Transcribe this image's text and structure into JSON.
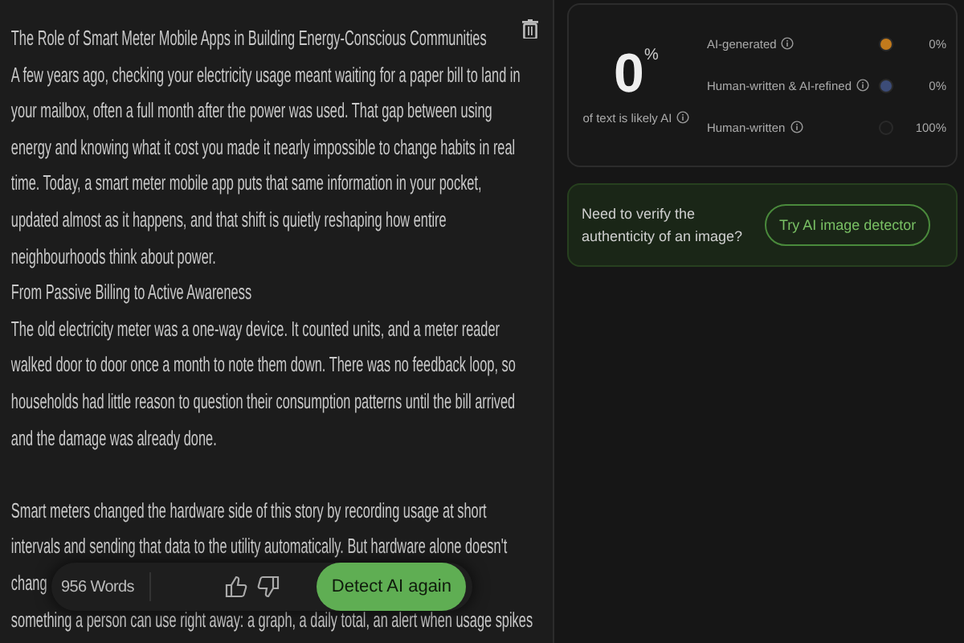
{
  "document": {
    "blocks": [
      {
        "kind": "title",
        "lines": [
          "The Role of Smart Meter Mobile Apps in Building Energy-Conscious Communities"
        ]
      },
      {
        "kind": "paragraph",
        "lines": [
          "A few years ago, checking your electricity usage meant waiting for a paper bill to land in",
          "your mailbox, often a full month after the power was used. That gap between using",
          "energy and knowing what it cost you made it nearly impossible to change habits in real",
          "time. Today, a smart meter mobile app puts that same information in your pocket,",
          "updated almost as it happens, and that shift is quietly reshaping how entire",
          "neighbourhoods think about power."
        ]
      },
      {
        "kind": "heading",
        "lines": [
          "From Passive Billing to Active Awareness"
        ]
      },
      {
        "kind": "paragraph",
        "lines": [
          "The old electricity meter was a one-way device. It counted units, and a meter reader",
          "walked door to door once a month to note them down. There was no feedback loop, so",
          "households had little reason to question their consumption patterns until the bill arrived",
          "and the damage was already done."
        ]
      },
      {
        "kind": "gap"
      },
      {
        "kind": "paragraph",
        "lines": [
          "Smart meters changed the hardware side of this story by recording usage at short",
          "intervals and sending that data to the utility automatically. But hardware alone doesn't"
        ]
      },
      {
        "kind": "fragment",
        "lines": [
          "chang"
        ]
      },
      {
        "kind": "fragment",
        "lines": [
          "something a person can use right away: a graph, a daily total, an alert when usage spikes"
        ]
      }
    ]
  },
  "toolbar": {
    "word_count": "956 Words",
    "detect_button": "Detect AI again"
  },
  "result": {
    "score": "0",
    "unit": "%",
    "caption": "of text is likely AI",
    "categories": [
      {
        "label": "AI-generated",
        "color": "#c27a1c",
        "percent": "0%"
      },
      {
        "label": "Human-written & AI-refined",
        "color": "#3c4c78",
        "percent": "0%"
      },
      {
        "label": "Human-written",
        "color": "#1a1a1a",
        "percent": "100%"
      }
    ]
  },
  "promo": {
    "text": "Need to verify the authenticity of an image?",
    "button": "Try AI image detector"
  }
}
